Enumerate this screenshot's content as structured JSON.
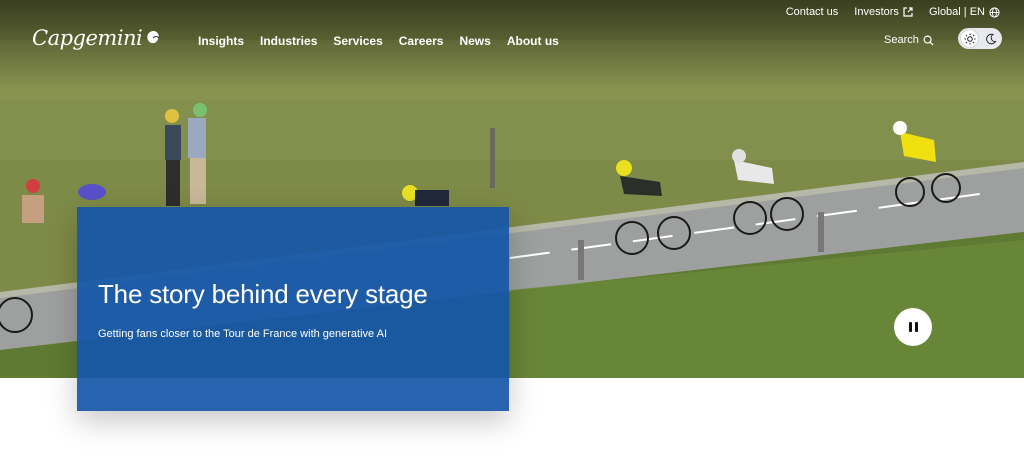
{
  "brand": {
    "name": "Capgemini",
    "accent": "#1556a8"
  },
  "utility": {
    "contact": "Contact us",
    "investors": "Investors",
    "region": "Global | EN"
  },
  "nav": {
    "items": [
      "Insights",
      "Industries",
      "Services",
      "Careers",
      "News",
      "About us"
    ],
    "search_label": "Search"
  },
  "hero": {
    "title": "The story behind every stage",
    "subtitle": "Getting fans closer to the Tour de France with generative AI"
  },
  "icons": {
    "external": "external-link-icon",
    "globe": "globe-icon",
    "search": "search-icon",
    "sun": "sun-icon",
    "moon": "moon-icon",
    "pause": "pause-icon"
  }
}
